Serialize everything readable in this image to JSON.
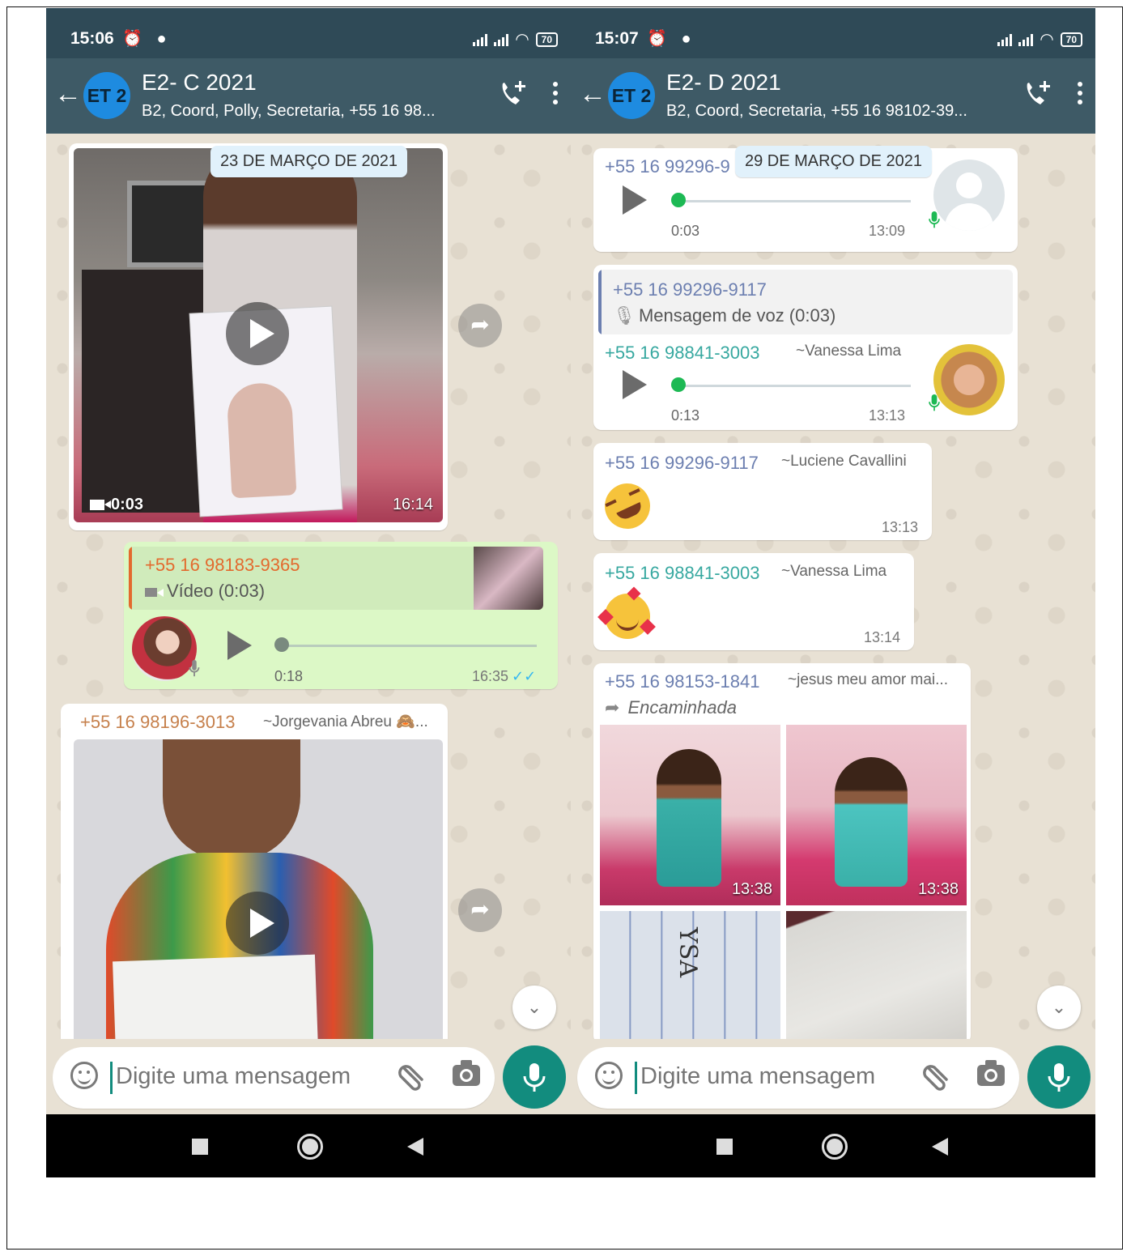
{
  "left": {
    "status": {
      "time": "15:06",
      "battery": "70"
    },
    "header": {
      "avatar_text": "ET 2",
      "title": "E2- C 2021",
      "subtitle": "B2, Coord, Polly, Secretaria, +55 16 98..."
    },
    "date_chip": "23 DE MARÇO DE 2021",
    "video1": {
      "duration": "0:03",
      "time": "16:14"
    },
    "reply": {
      "quoted_sender": "+55 16 98183-9365",
      "quoted_text": "Vídeo (0:03)",
      "audio_duration": "0:18",
      "time": "16:35",
      "ticks": "✓✓"
    },
    "video2": {
      "sender": "+55 16 98196-3013",
      "alias": "~Jorgevania Abreu 🙈..."
    },
    "input_placeholder": "Digite uma mensagem"
  },
  "right": {
    "status": {
      "time": "15:07",
      "battery": "70"
    },
    "header": {
      "avatar_text": "ET 2",
      "title": "E2- D 2021",
      "subtitle": "B2, Coord, Secretaria, +55 16 98102-39..."
    },
    "date_chip": "29 DE MARÇO DE 2021",
    "audio1": {
      "sender": "+55 16 99296-9",
      "duration": "0:03",
      "time": "13:09"
    },
    "reply": {
      "quoted_sender": "+55 16 99296-9117",
      "quoted_text": "Mensagem de voz (0:03)",
      "sender": "+55 16 98841-3003",
      "alias": "~Vanessa Lima",
      "duration": "0:13",
      "time": "13:13"
    },
    "emoji1": {
      "sender": "+55 16 99296-9117",
      "alias": "~Luciene Cavallini",
      "time": "13:13"
    },
    "emoji2": {
      "sender": "+55 16 98841-3003",
      "alias": "~Vanessa Lima",
      "time": "13:14"
    },
    "album": {
      "sender": "+55 16 98153-1841",
      "alias": "~jesus meu amor mai...",
      "forwarded_label": "Encaminhada",
      "time1": "13:38",
      "time2": "13:38",
      "paper_text": "YSA"
    },
    "input_placeholder": "Digite uma mensagem"
  },
  "colors": {
    "header": "#3e5a66",
    "statusbar": "#2f4a57",
    "accent_green": "#128c7e",
    "outgoing_bubble": "#dcf8c6",
    "audio_dot_green": "#1db954",
    "sender_orange": "#e36a2e",
    "sender_teal": "#37a8a0",
    "sender_blue": "#6c7fb0"
  }
}
